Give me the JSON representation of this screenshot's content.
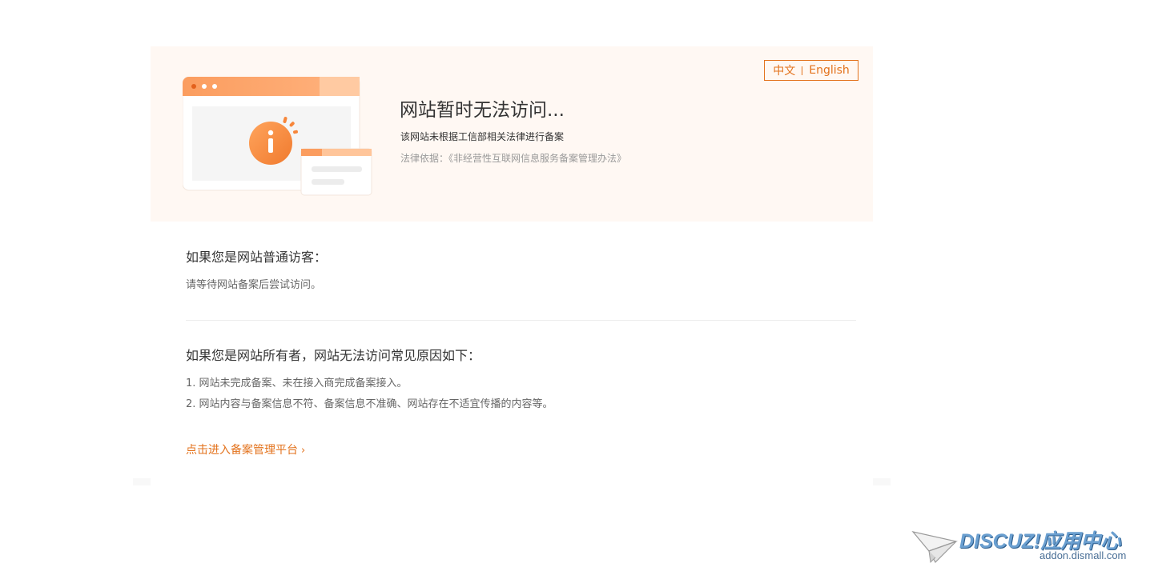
{
  "lang": {
    "zh": "中文",
    "en": "English"
  },
  "hero": {
    "title": "网站暂时无法访问...",
    "subtitle": "该网站未根据工信部相关法律进行备案",
    "law": "法律依据：《非经营性互联网信息服务备案管理办法》"
  },
  "visitor": {
    "title": "如果您是网站普通访客：",
    "text": "请等待网站备案后尝试访问。"
  },
  "owner": {
    "title": "如果您是网站所有者，网站无法访问常见原因如下：",
    "reasons": [
      "1. 网站未完成备案、未在接入商完成备案接入。",
      "2. 网站内容与备案信息不符、备案信息不准确、网站存在不适宜传播的内容等。"
    ]
  },
  "cta": {
    "label": "点击进入备案管理平台",
    "arrow": "›"
  },
  "watermark": {
    "brand": "DISCUZ!应用中心",
    "url": "addon.dismall.com"
  },
  "colors": {
    "accent": "#e3721c",
    "card_bg": "#fff8f3",
    "info_icon": "#f7863a"
  },
  "icons": {
    "illustration": "browser-info-illustration",
    "cta_arrow": "chevron-right-icon"
  }
}
